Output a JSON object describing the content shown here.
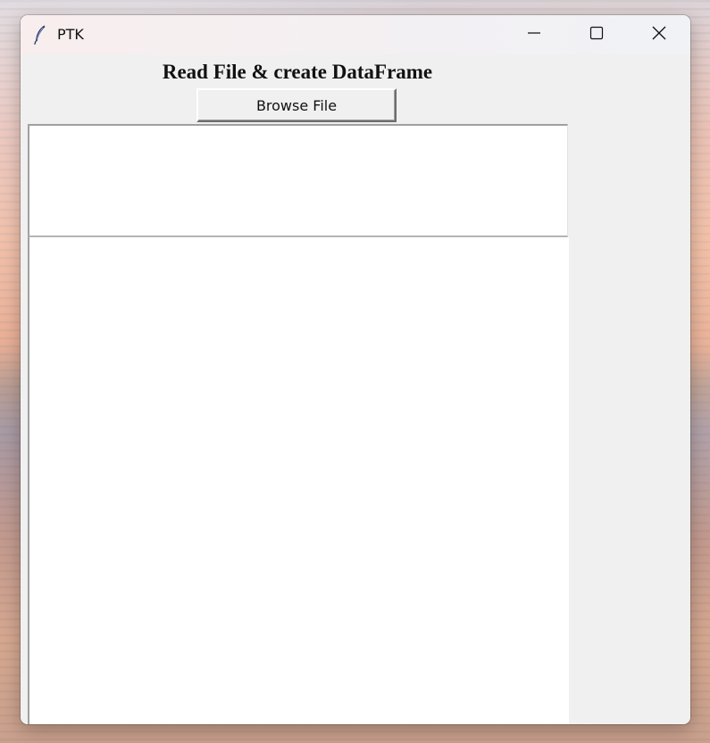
{
  "window": {
    "title": "PTK",
    "icons": {
      "app": "feather-icon",
      "minimize": "minimize-icon",
      "maximize": "maximize-icon",
      "close": "close-icon"
    }
  },
  "main": {
    "heading": "Read File & create DataFrame",
    "browse_button_label": "Browse File",
    "top_text_area_value": "",
    "bottom_text_area_value": ""
  },
  "colors": {
    "window_bg": "#f0f0f0",
    "text_area_bg": "#ffffff"
  }
}
